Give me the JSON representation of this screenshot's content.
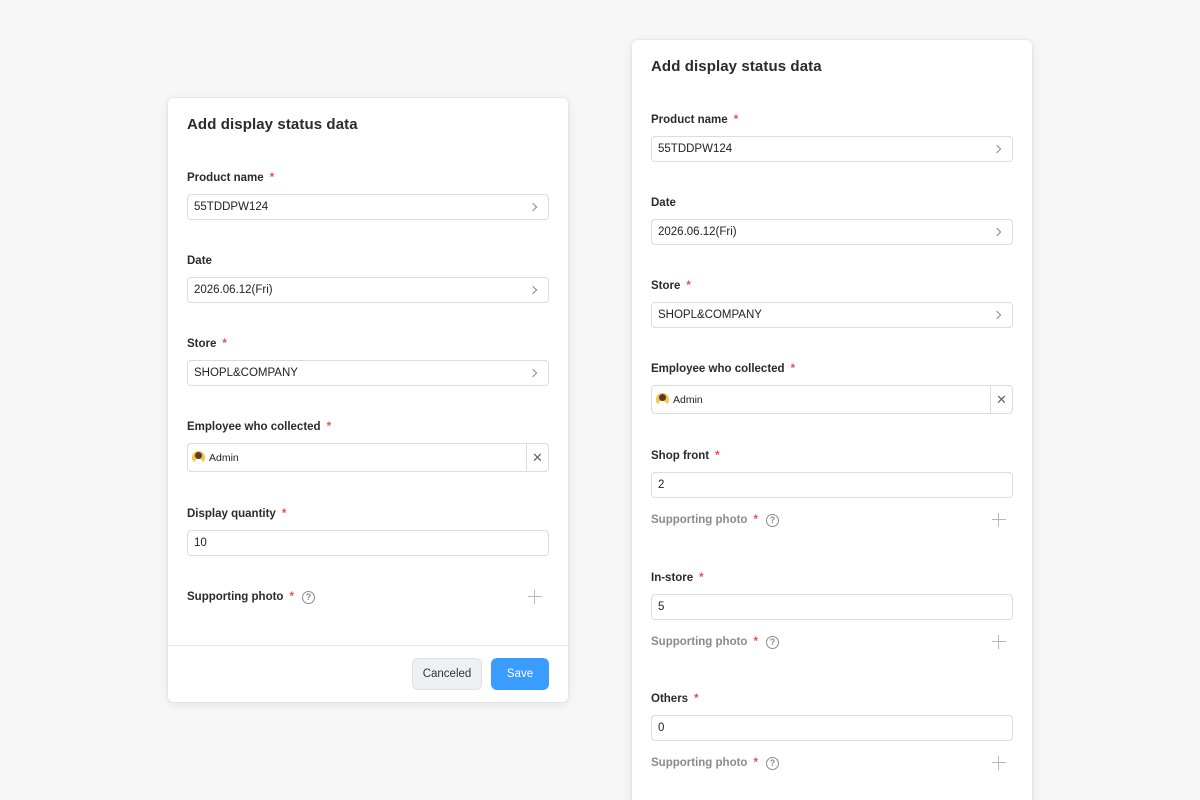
{
  "left_modal": {
    "title": "Add display status data",
    "product": {
      "label": "Product name",
      "value": "55TDDPW124"
    },
    "date": {
      "label": "Date",
      "value": "2026.06.12(Fri)"
    },
    "store": {
      "label": "Store",
      "value": "SHOPL&COMPANY"
    },
    "employee": {
      "label": "Employee who collected",
      "value": "Admin"
    },
    "quantity": {
      "label": "Display quantity",
      "value": "10"
    },
    "photo": {
      "label": "Supporting photo"
    },
    "cancel_label": "Canceled",
    "save_label": "Save"
  },
  "right_modal": {
    "title": "Add display status data",
    "product": {
      "label": "Product name",
      "value": "55TDDPW124"
    },
    "date": {
      "label": "Date",
      "value": "2026.06.12(Fri)"
    },
    "store": {
      "label": "Store",
      "value": "SHOPL&COMPANY"
    },
    "employee": {
      "label": "Employee who collected",
      "value": "Admin"
    },
    "shop_front": {
      "label": "Shop front",
      "value": "2",
      "photo_label": "Supporting photo"
    },
    "in_store": {
      "label": "In-store",
      "value": "5",
      "photo_label": "Supporting photo"
    },
    "others": {
      "label": "Others",
      "value": "0",
      "photo_label": "Supporting photo"
    }
  },
  "required_mark": "*",
  "help_glyph": "?",
  "clear_glyph": "✕",
  "icons": [
    "chevron-right-icon",
    "close-icon",
    "help-icon",
    "plus-icon",
    "avatar"
  ],
  "colors": {
    "required": "#ee4d4d",
    "save_button": "#3b9cff",
    "muted_label": "#8b8b8b"
  }
}
